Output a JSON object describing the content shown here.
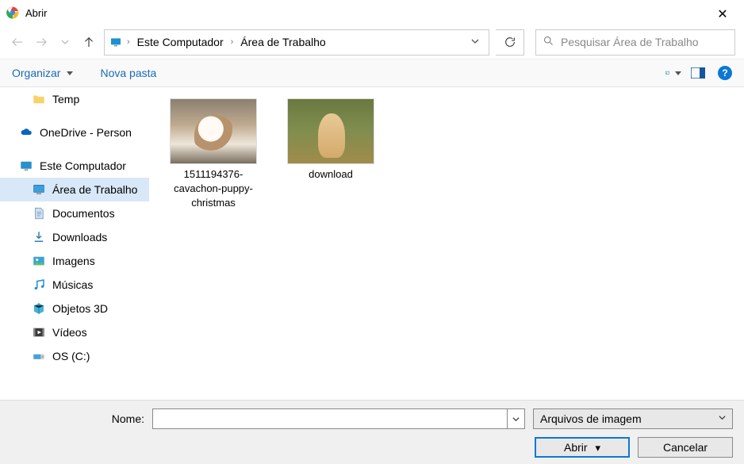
{
  "title": "Abrir",
  "breadcrumbs": [
    "Este Computador",
    "Área de Trabalho"
  ],
  "search": {
    "placeholder": "Pesquisar Área de Trabalho"
  },
  "toolbar": {
    "organize": "Organizar",
    "new_folder": "Nova pasta"
  },
  "sidebar": {
    "items": [
      {
        "label": "Temp",
        "icon": "folder",
        "indent": "child"
      },
      {
        "label": "OneDrive - Person",
        "icon": "onedrive",
        "indent": "root"
      },
      {
        "label": "Este Computador",
        "icon": "pc",
        "indent": "root"
      },
      {
        "label": "Área de Trabalho",
        "icon": "desktop",
        "indent": "child",
        "selected": true
      },
      {
        "label": "Documentos",
        "icon": "documents",
        "indent": "child"
      },
      {
        "label": "Downloads",
        "icon": "downloads",
        "indent": "child"
      },
      {
        "label": "Imagens",
        "icon": "images",
        "indent": "child"
      },
      {
        "label": "Músicas",
        "icon": "music",
        "indent": "child"
      },
      {
        "label": "Objetos 3D",
        "icon": "objects3d",
        "indent": "child"
      },
      {
        "label": "Vídeos",
        "icon": "videos",
        "indent": "child"
      },
      {
        "label": "OS (C:)",
        "icon": "disk",
        "indent": "child"
      }
    ]
  },
  "files": [
    {
      "name": "1511194376-cavachon-puppy-christmas",
      "thumb": "dog1"
    },
    {
      "name": "download",
      "thumb": "dog2"
    }
  ],
  "footer": {
    "name_label": "Nome:",
    "name_value": "",
    "filter": "Arquivos de imagem",
    "open": "Abrir",
    "cancel": "Cancelar"
  }
}
